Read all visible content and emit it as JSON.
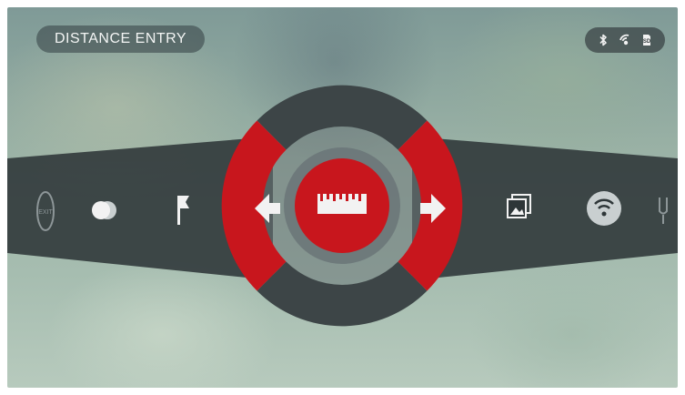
{
  "header": {
    "title": "DISTANCE ENTRY"
  },
  "status_bar": {
    "icons": [
      "bluetooth-icon",
      "wifi-connected-icon",
      "sd-card-icon"
    ],
    "sd_label": "SD"
  },
  "carousel": {
    "selected": "distance-entry-icon",
    "left_items": [
      "exit-icon",
      "contrast-icon",
      "waypoint-flag-icon"
    ],
    "right_items": [
      "gallery-icon",
      "wifi-icon",
      "rifle-profile-icon"
    ],
    "exit_label": "EXIT"
  },
  "dial": {
    "left_button_icon": "arrow-left-icon",
    "right_button_icon": "arrow-right-icon",
    "up_button_icon": "none",
    "down_button_icon": "none",
    "center_button_icon": "ruler-icon"
  },
  "colors": {
    "accent_red": "#c8161d",
    "band_dark": "#2e3638",
    "dial_segment": "#3d4547",
    "dial_ring": "#6b7779",
    "icon_white": "#f2f2f2"
  }
}
